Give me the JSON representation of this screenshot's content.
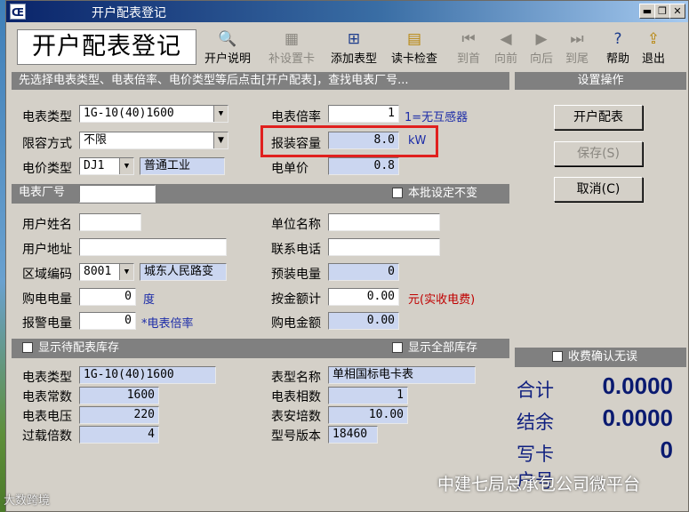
{
  "window": {
    "title": "开户配表登记",
    "app_icon": "Œ",
    "min": "▬",
    "max": "❐",
    "close": "✕"
  },
  "toolbar": {
    "heading": "开户配表登记",
    "buttons": [
      {
        "label": "开户说明",
        "icon": "search-doc-icon"
      },
      {
        "label": "补设置卡",
        "icon": "card-icon"
      },
      {
        "label": "添加表型",
        "icon": "grid-add-icon"
      },
      {
        "label": "读卡检查",
        "icon": "card-read-icon"
      },
      {
        "label": "到首",
        "icon": "first-icon"
      },
      {
        "label": "向前",
        "icon": "prev-icon"
      },
      {
        "label": "向后",
        "icon": "next-icon"
      },
      {
        "label": "到尾",
        "icon": "last-icon"
      },
      {
        "label": "帮助",
        "icon": "help-icon"
      },
      {
        "label": "退出",
        "icon": "exit-icon"
      }
    ]
  },
  "instruction": "先选择电表类型、电表倍率、电价类型等后点击[开户配表]，查找电表厂号...",
  "form": {
    "meter_type_label": "电表类型",
    "meter_type_value": "1G-10(40)1600",
    "limit_mode_label": "限容方式",
    "limit_mode_value": "不限",
    "price_type_label": "电价类型",
    "price_type_code": "DJ1",
    "price_type_name": "普通工业",
    "ratio_label": "电表倍率",
    "ratio_value": "1",
    "ratio_hint": "1=无互感器",
    "capacity_label": "报装容量",
    "capacity_value": "8.0",
    "capacity_unit": "kW",
    "unit_price_label": "电单价",
    "unit_price_value": "0.8"
  },
  "factory": {
    "label": "电表厂号",
    "value": "",
    "keep_label": "本批设定不变"
  },
  "user": {
    "name_label": "用户姓名",
    "name_value": "",
    "addr_label": "用户地址",
    "addr_value": "",
    "area_label": "区域编码",
    "area_code": "8001",
    "area_name": "城东人民路变",
    "buy_label": "购电电量",
    "buy_value": "0",
    "buy_unit": "度",
    "alarm_label": "报警电量",
    "alarm_value": "0",
    "alarm_hint": "*电表倍率",
    "company_label": "单位名称",
    "company_value": "",
    "phone_label": "联系电话",
    "phone_value": "",
    "prepaid_label": "预装电量",
    "prepaid_value": "0",
    "amount_label": "按金额计",
    "amount_value": "0.00",
    "amount_hint": "元(实收电费)",
    "buy_amount_label": "购电金额",
    "buy_amount_value": "0.00"
  },
  "stock": {
    "show_pending_label": "显示待配表库存",
    "show_all_label": "显示全部库存",
    "type_label": "电表类型",
    "type_value": "1G-10(40)1600",
    "const_label": "电表常数",
    "const_value": "1600",
    "voltage_label": "电表电压",
    "voltage_value": "220",
    "overload_label": "过载倍数",
    "overload_value": "4",
    "model_label": "表型名称",
    "model_value": "单相国标电卡表",
    "phase_label": "电表相数",
    "phase_value": "1",
    "amp_label": "表安培数",
    "amp_value": "10.00",
    "version_label": "型号版本",
    "version_value": "18460"
  },
  "side": {
    "heading": "设置操作",
    "open_btn": "开户配表",
    "save_btn": "保存(S)",
    "cancel_btn": "取消(C)",
    "confirm_label": "收费确认无误",
    "total_label": "合计",
    "total_value": "0.0000",
    "settle_label": "结余",
    "settle_value": "0.0000",
    "write_label": "写卡",
    "write_value": "0",
    "extra_label": "户号"
  },
  "overlay": {
    "watermark": "中建七局总承包公司微平台",
    "corner": "大数跨境"
  },
  "colors": {
    "highlight": "#e0201e",
    "readonly_field": "#cbd6f0",
    "title_bar": "#0a246a"
  }
}
